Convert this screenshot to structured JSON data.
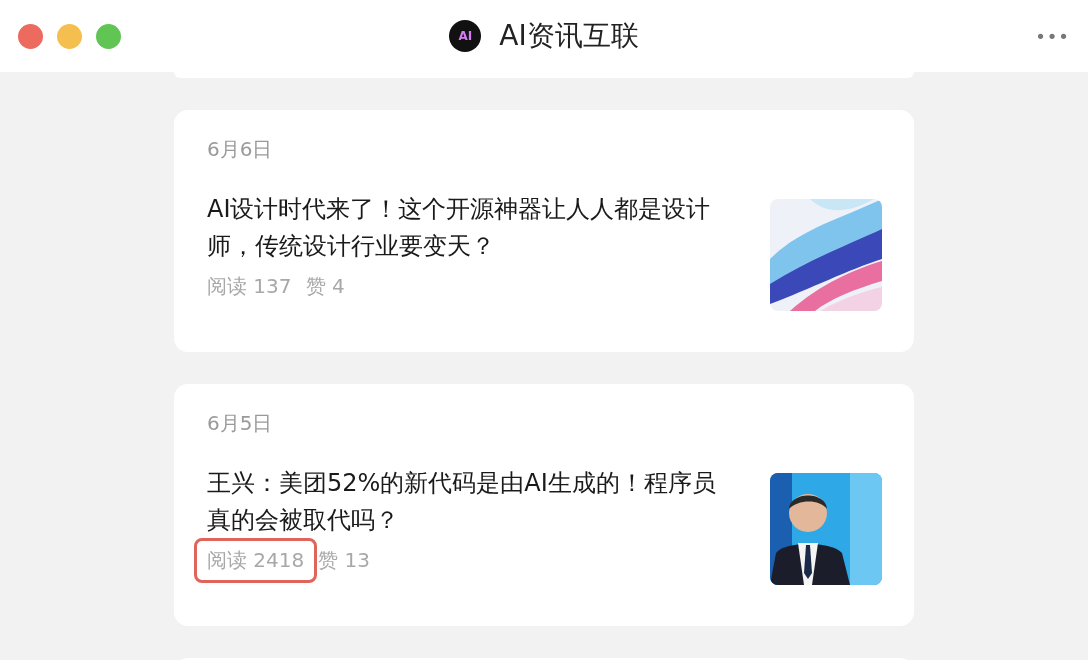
{
  "window": {
    "title": "AI资讯互联",
    "logo_text": "AI",
    "menu": "•••"
  },
  "articles": [
    {
      "date": "6月6日",
      "title": "AI设计时代来了！这个开源神器让人人都是设计师，传统设计行业要变天？",
      "reads": "阅读 137",
      "likes": "赞 4",
      "reads_highlighted": false
    },
    {
      "date": "6月5日",
      "title": "王兴：美团52%的新代码是由AI生成的！程序员真的会被取代吗？",
      "reads": "阅读 2418",
      "likes": "赞 13",
      "reads_highlighted": true
    }
  ]
}
